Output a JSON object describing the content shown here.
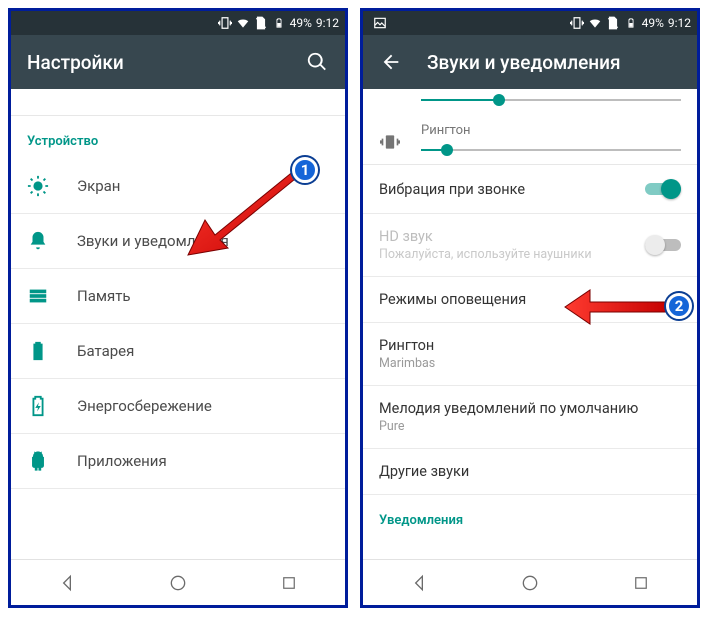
{
  "status": {
    "battery_pct": "49%",
    "time": "9:12"
  },
  "left": {
    "title": "Настройки",
    "section": "Устройство",
    "items": [
      {
        "label": "Экран"
      },
      {
        "label": "Звуки и уведомления"
      },
      {
        "label": "Память"
      },
      {
        "label": "Батарея"
      },
      {
        "label": "Энергосбережение"
      },
      {
        "label": "Приложения"
      }
    ]
  },
  "right": {
    "title": "Звуки и уведомления",
    "ringtone_label": "Рингтон",
    "rows": {
      "vibrate": {
        "title": "Вибрация при звонке"
      },
      "hd": {
        "title": "HD звук",
        "sub": "Пожалуйста, используйте наушники"
      },
      "modes": {
        "title": "Режимы оповещения"
      },
      "ringtone": {
        "title": "Рингтон",
        "sub": "Marimbas"
      },
      "notif": {
        "title": "Мелодия уведомлений по умолчанию",
        "sub": "Pure"
      },
      "other": {
        "title": "Другие звуки"
      }
    },
    "section2": "Уведомления"
  },
  "markers": {
    "one": "1",
    "two": "2"
  }
}
